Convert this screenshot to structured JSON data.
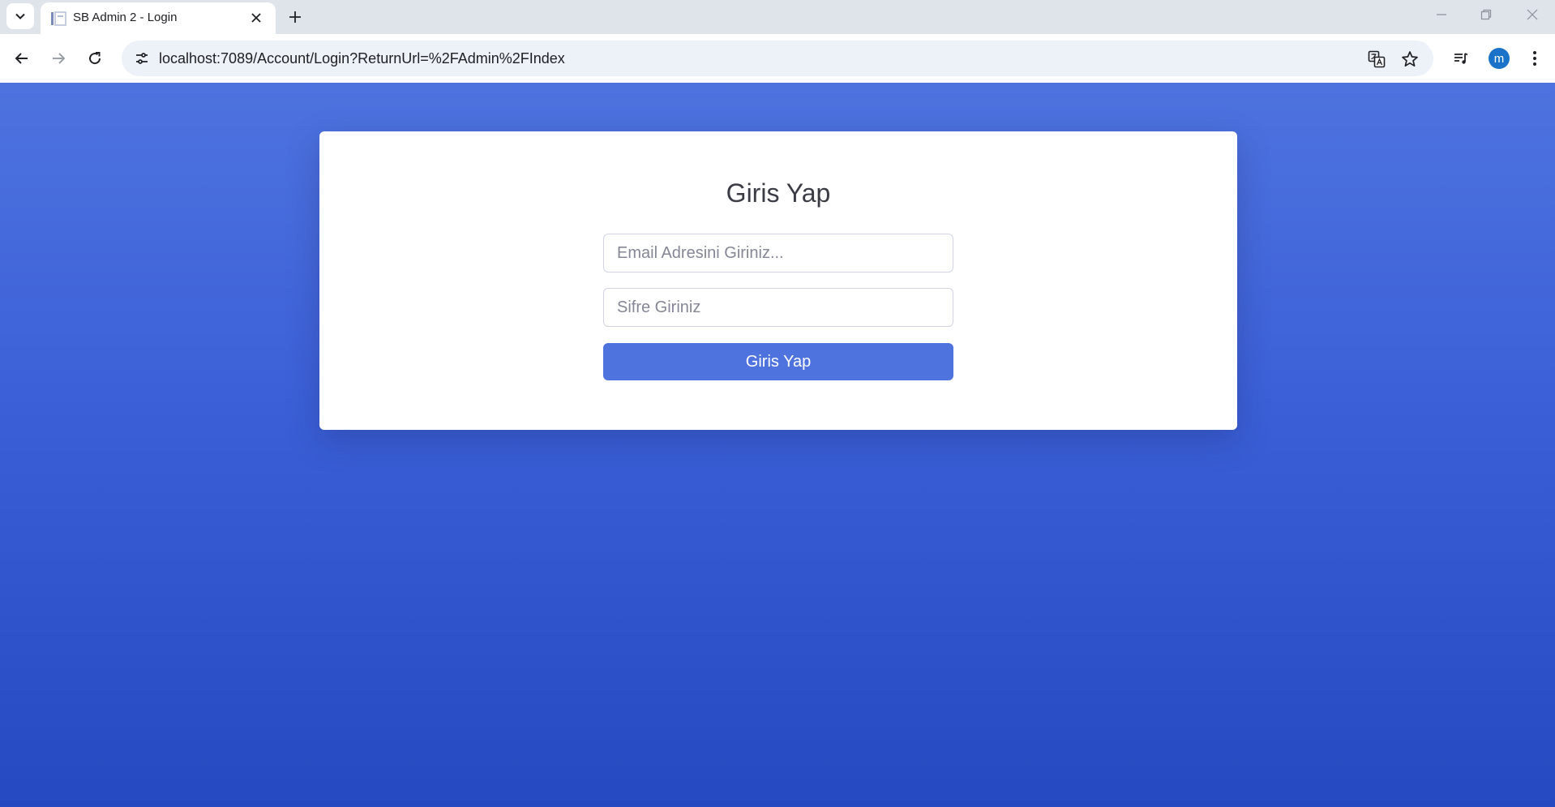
{
  "browser": {
    "tab": {
      "title": "SB Admin 2 - Login",
      "favicon": "page-icon"
    },
    "address_bar": {
      "url": "localhost:7089/Account/Login?ReturnUrl=%2FAdmin%2FIndex"
    },
    "profile": {
      "initial": "m",
      "color": "#1a73c9"
    }
  },
  "login": {
    "title": "Giris Yap",
    "email_placeholder": "Email Adresini Giriniz...",
    "email_value": "",
    "password_placeholder": "Sifre Giriniz",
    "password_value": "",
    "submit_label": "Giris Yap"
  },
  "colors": {
    "primary": "#4e73df",
    "background_top": "#4e73df",
    "background_bottom": "#2549c0",
    "card": "#ffffff",
    "title_text": "#3a3b45"
  }
}
